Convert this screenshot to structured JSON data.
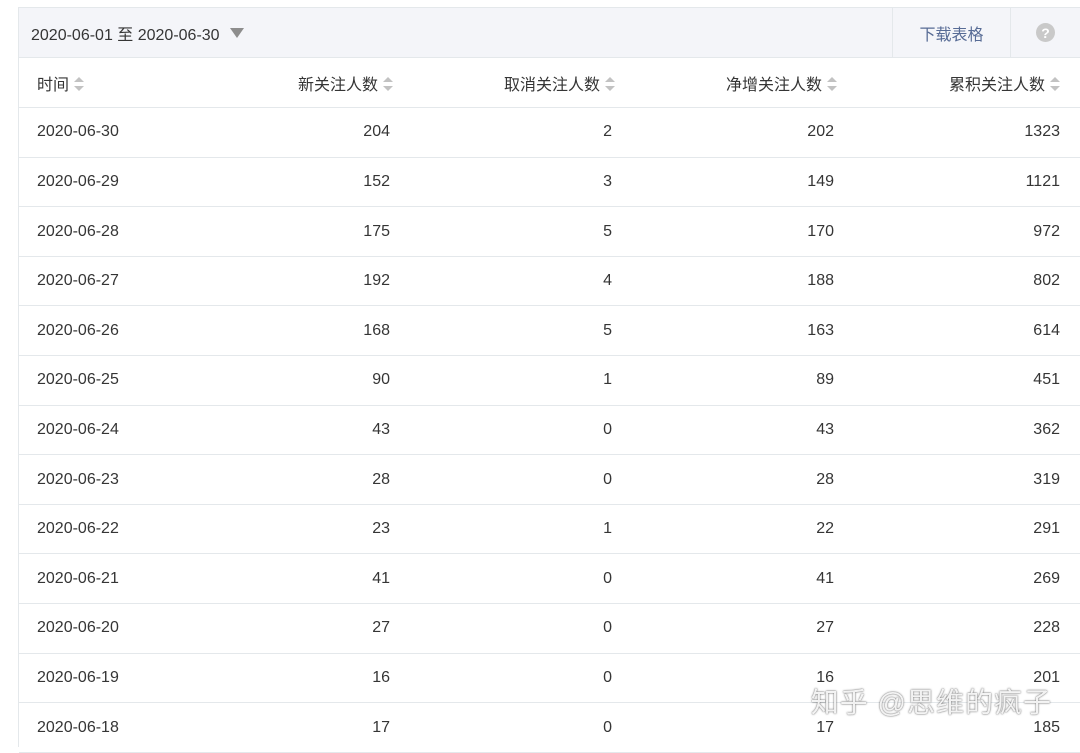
{
  "toolbar": {
    "date_range": "2020-06-01 至 2020-06-30",
    "download_label": "下载表格",
    "help_label": "?"
  },
  "table": {
    "headers": [
      "时间",
      "新关注人数",
      "取消关注人数",
      "净增关注人数",
      "累积关注人数"
    ],
    "rows": [
      [
        "2020-06-30",
        "204",
        "2",
        "202",
        "1323"
      ],
      [
        "2020-06-29",
        "152",
        "3",
        "149",
        "1121"
      ],
      [
        "2020-06-28",
        "175",
        "5",
        "170",
        "972"
      ],
      [
        "2020-06-27",
        "192",
        "4",
        "188",
        "802"
      ],
      [
        "2020-06-26",
        "168",
        "5",
        "163",
        "614"
      ],
      [
        "2020-06-25",
        "90",
        "1",
        "89",
        "451"
      ],
      [
        "2020-06-24",
        "43",
        "0",
        "43",
        "362"
      ],
      [
        "2020-06-23",
        "28",
        "0",
        "28",
        "319"
      ],
      [
        "2020-06-22",
        "23",
        "1",
        "22",
        "291"
      ],
      [
        "2020-06-21",
        "41",
        "0",
        "41",
        "269"
      ],
      [
        "2020-06-20",
        "27",
        "0",
        "27",
        "228"
      ],
      [
        "2020-06-19",
        "16",
        "0",
        "16",
        "201"
      ],
      [
        "2020-06-18",
        "17",
        "0",
        "17",
        "185"
      ]
    ]
  },
  "watermark": "知乎 @思维的疯子",
  "colors": {
    "accent_link": "#576b95",
    "toolbar_bg": "#f4f5f9",
    "border": "#e4e8eb"
  }
}
